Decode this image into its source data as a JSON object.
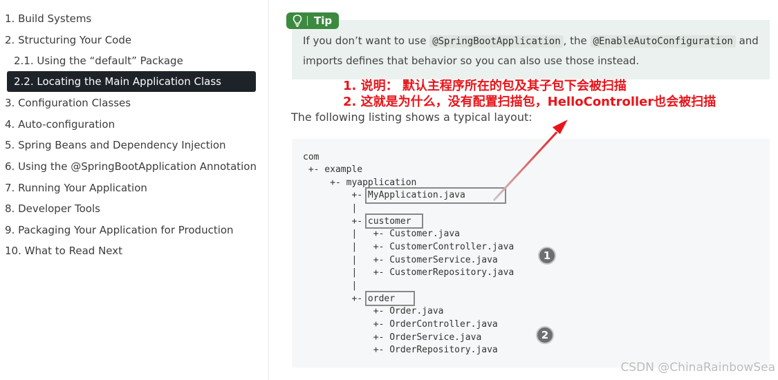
{
  "sidebar": {
    "items": [
      {
        "label": "1. Build Systems"
      },
      {
        "label": "2. Structuring Your Code"
      },
      {
        "label": "2.1. Using the “default” Package"
      },
      {
        "label": "2.2. Locating the Main Application Class"
      },
      {
        "label": "3. Configuration Classes"
      },
      {
        "label": "4. Auto-configuration"
      },
      {
        "label": "5. Spring Beans and Dependency Injection"
      },
      {
        "label": "6. Using the @SpringBootApplication Annotation"
      },
      {
        "label": "7. Running Your Application"
      },
      {
        "label": "8. Developer Tools"
      },
      {
        "label": "9. Packaging Your Application for Production"
      },
      {
        "label": "10. What to Read Next"
      }
    ]
  },
  "tip": {
    "badge": "Tip",
    "text_before": "If you don’t want to use ",
    "code1": "@SpringBootApplication",
    "text_mid": ", the ",
    "code2": "@EnableAutoConfiguration",
    "text_after": " and",
    "line2": "imports defines that behavior so you can also use those instead."
  },
  "annotation": {
    "line1": "1. 说明： 默认主程序所在的包及其子包下会被扫描",
    "line2": "2. 这就是为什么，没有配置扫描包，HelloController也会被扫描"
  },
  "listing_intro": "The following listing shows a typical layout:",
  "code_lines": [
    "com",
    " +- example",
    "     +- myapplication",
    "         +- MyApplication.java",
    "         |",
    "         +- customer",
    "         |   +- Customer.java",
    "         |   +- CustomerController.java",
    "         |   +- CustomerService.java",
    "         |   +- CustomerRepository.java",
    "         |",
    "         +- order",
    "             +- Order.java",
    "             +- OrderController.java",
    "             +- OrderService.java",
    "             +- OrderRepository.java"
  ],
  "markers": [
    "1",
    "2"
  ],
  "watermark": "CSDN @ChinaRainbowSea",
  "colors": {
    "tip_green": "#3b8a3f",
    "annotation_red": "#e8141a",
    "active_nav": "#1e2329"
  }
}
